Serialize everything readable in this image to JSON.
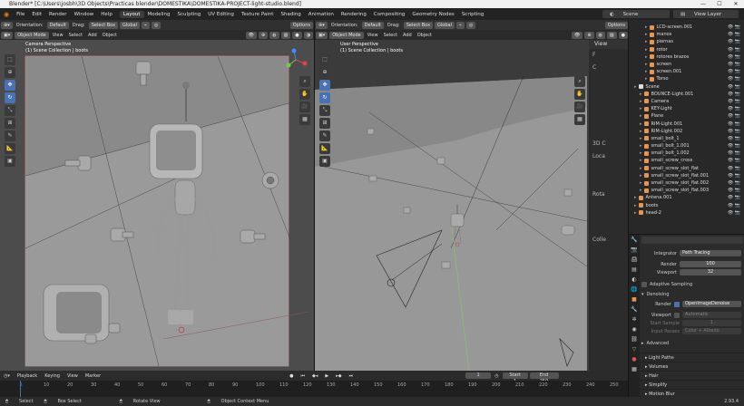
{
  "window": {
    "title": "Blender* [C:\\Users\\josbh\\3D Objects\\Practicas blender\\DOMESTIKA\\DOMESTIKA-PROJECT-light-studio.blend]",
    "minimize": "—",
    "maximize": "☐",
    "close": "✕"
  },
  "menu": [
    "File",
    "Edit",
    "Render",
    "Window",
    "Help"
  ],
  "workspaces": [
    "Layout",
    "Modeling",
    "Sculpting",
    "UV Editing",
    "Texture Paint",
    "Shading",
    "Animation",
    "Rendering",
    "Compositing",
    "Geometry Nodes",
    "Scripting"
  ],
  "active_workspace": "Layout",
  "scene_field": "Scene",
  "view_layer_field": "View Layer",
  "viewport_left": {
    "mode": "Object Mode",
    "menus": [
      "View",
      "Select",
      "Add",
      "Object"
    ],
    "orientation_label": "Orientation:",
    "drag_label": "Drag:",
    "orientation": "Default",
    "drag": "Select Box",
    "pivot": "Global",
    "options": "Options",
    "overlay_line1": "Camera Perspective",
    "overlay_line2": "(1) Scene Collection | boots"
  },
  "viewport_right": {
    "mode": "Object Mode",
    "menus": [
      "View",
      "Select",
      "Add",
      "Object"
    ],
    "orientation_label": "Orientation:",
    "drag_label": "Drag:",
    "orientation": "Default",
    "drag": "Select Box",
    "pivot": "Global",
    "options": "Options",
    "overlay_line1": "User Perspective",
    "overlay_line2": "(1) Scene Collection | boots",
    "npanel_tab": "View",
    "npanel_labels": [
      "F",
      "C",
      "3D C",
      "Loca",
      "Rota",
      "Colle"
    ]
  },
  "outliner": {
    "rows": [
      {
        "name": "LCD-screen.001",
        "indent": 2,
        "color": "#e8954f"
      },
      {
        "name": "manos",
        "indent": 2,
        "color": "#e8954f"
      },
      {
        "name": "piernas",
        "indent": 2,
        "color": "#e8954f"
      },
      {
        "name": "rotor",
        "indent": 2,
        "color": "#e8954f"
      },
      {
        "name": "rotores brazos",
        "indent": 2,
        "color": "#e8954f"
      },
      {
        "name": "screen",
        "indent": 2,
        "color": "#e8954f"
      },
      {
        "name": "screen.001",
        "indent": 2,
        "color": "#e8954f"
      },
      {
        "name": "Torso",
        "indent": 2,
        "color": "#e8954f"
      },
      {
        "name": "Scene",
        "indent": 0,
        "color": "#dddddd"
      },
      {
        "name": "BOUNCE-Light.001",
        "indent": 1,
        "color": "#e8954f"
      },
      {
        "name": "Camera",
        "indent": 1,
        "color": "#e8954f"
      },
      {
        "name": "KEY-Light",
        "indent": 1,
        "color": "#e8954f"
      },
      {
        "name": "Plane",
        "indent": 1,
        "color": "#e8954f"
      },
      {
        "name": "RIM-Light.001",
        "indent": 1,
        "color": "#e8954f"
      },
      {
        "name": "RIM-Light.002",
        "indent": 1,
        "color": "#e8954f"
      },
      {
        "name": "small_bolt_1",
        "indent": 1,
        "color": "#e8954f"
      },
      {
        "name": "small_bolt_1.001",
        "indent": 1,
        "color": "#e8954f"
      },
      {
        "name": "small_bolt_1.002",
        "indent": 1,
        "color": "#e8954f"
      },
      {
        "name": "small_screw_cross",
        "indent": 1,
        "color": "#e8954f"
      },
      {
        "name": "small_screw_slot_flat",
        "indent": 1,
        "color": "#e8954f"
      },
      {
        "name": "small_screw_slot_flat.001",
        "indent": 1,
        "color": "#e8954f"
      },
      {
        "name": "small_screw_slot_flat.002",
        "indent": 1,
        "color": "#e8954f"
      },
      {
        "name": "small_screw_slot_flat.003",
        "indent": 1,
        "color": "#e8954f"
      },
      {
        "name": "Antena.001",
        "indent": 0,
        "color": "#e8954f"
      },
      {
        "name": "boots",
        "indent": 0,
        "color": "#e8954f"
      },
      {
        "name": "head-2",
        "indent": 0,
        "color": "#e8954f"
      }
    ]
  },
  "properties": {
    "integrator_label": "Integrator",
    "integrator": "Path Tracing",
    "render_label": "Render",
    "render_samples": "100",
    "viewport_label": "Viewport",
    "viewport_samples": "32",
    "adaptive_sampling": "Adaptive Sampling",
    "denoising": "Denoising",
    "denoise_render_label": "Render",
    "denoiser": "OpenImageDenoise",
    "denoise_viewport_label": "Viewport",
    "denoise_viewport": "Automatic",
    "start_sample_label": "Start Sample",
    "start_sample": "1",
    "input_passes_label": "Input Passes",
    "input_passes": "Color + Albedo",
    "advanced": "Advanced",
    "panels": [
      "Light Paths",
      "Volumes",
      "Hair",
      "Simplify",
      "Motion Blur"
    ]
  },
  "timeline": {
    "menus": [
      "Playback",
      "Keying",
      "View",
      "Marker"
    ],
    "current_frame": "1",
    "start_label": "Start",
    "start": "1",
    "end_label": "End",
    "end": "250",
    "ticks": [
      "1",
      "10",
      "20",
      "30",
      "40",
      "50",
      "60",
      "70",
      "80",
      "90",
      "100",
      "110",
      "120",
      "130",
      "140",
      "150",
      "160",
      "170",
      "180",
      "190",
      "200",
      "210",
      "220",
      "230",
      "240",
      "250"
    ]
  },
  "status": {
    "select": "Select",
    "box_select": "Box Select",
    "rotate_view": "Rotate View",
    "context_menu": "Object Context Menu",
    "version": "2.93.4"
  },
  "colors": {
    "accent": "#4772b3",
    "object_orange": "#e8954f",
    "mesh_green": "#76c56a",
    "viewport_left_bg": "#6e6e6e",
    "viewport_right_bg": "#3c3c3c"
  }
}
